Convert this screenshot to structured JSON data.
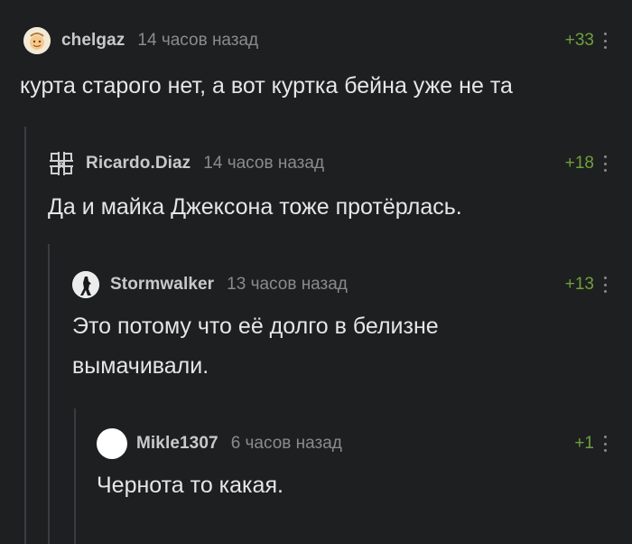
{
  "comments": [
    {
      "username": "chelgaz",
      "time": "14 часов назад",
      "rating": "+33",
      "text": "курта старого нет, а вот куртка бейна уже не та",
      "avatar_icon": "emoji-face-avatar"
    },
    {
      "username": "Ricardo.Diaz",
      "time": "14 часов назад",
      "rating": "+18",
      "text": "Да и майка Джексона тоже протёрлась.",
      "avatar_icon": "rammstein-logo-avatar"
    },
    {
      "username": "Stormwalker",
      "time": "13 часов назад",
      "rating": "+13",
      "text_line1": "Это потому что её долго в белизне",
      "text_line2": "вымачивали.",
      "avatar_icon": "silhouette-avatar"
    },
    {
      "username": "Mikle1307",
      "time": "6 часов назад",
      "rating": "+1",
      "text": "Чернота то какая.",
      "avatar_icon": "blank-white-avatar"
    }
  ],
  "colors": {
    "background": "#1e1f21",
    "rating_positive": "#6fa03a",
    "thread_line": "#3a3c3f"
  }
}
